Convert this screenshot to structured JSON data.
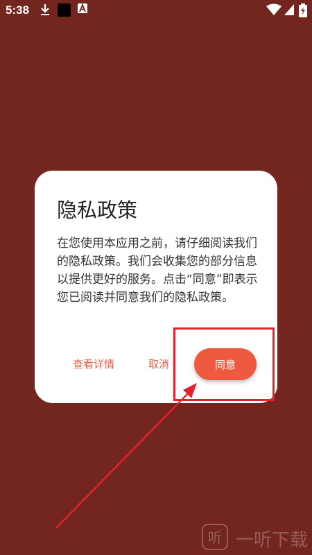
{
  "status_bar": {
    "time": "5:38",
    "icons": [
      "download-icon",
      "black-square-icon",
      "a-icon",
      "wifi-icon",
      "signal-icon",
      "battery-icon"
    ]
  },
  "dialog": {
    "title": "隐私政策",
    "body": "在您使用本应用之前，请仔细阅读我们的隐私政策。我们会收集您的部分信息以提供更好的服务。点击“同意”即表示您已阅读并同意我们的隐私政策。",
    "details_label": "查看详情",
    "cancel_label": "取消",
    "agree_label": "同意"
  },
  "watermark": {
    "text": "一听下载"
  },
  "colors": {
    "background": "#732620",
    "accent": "#ee5a40",
    "link": "#e26048",
    "highlight": "#e8202a"
  }
}
